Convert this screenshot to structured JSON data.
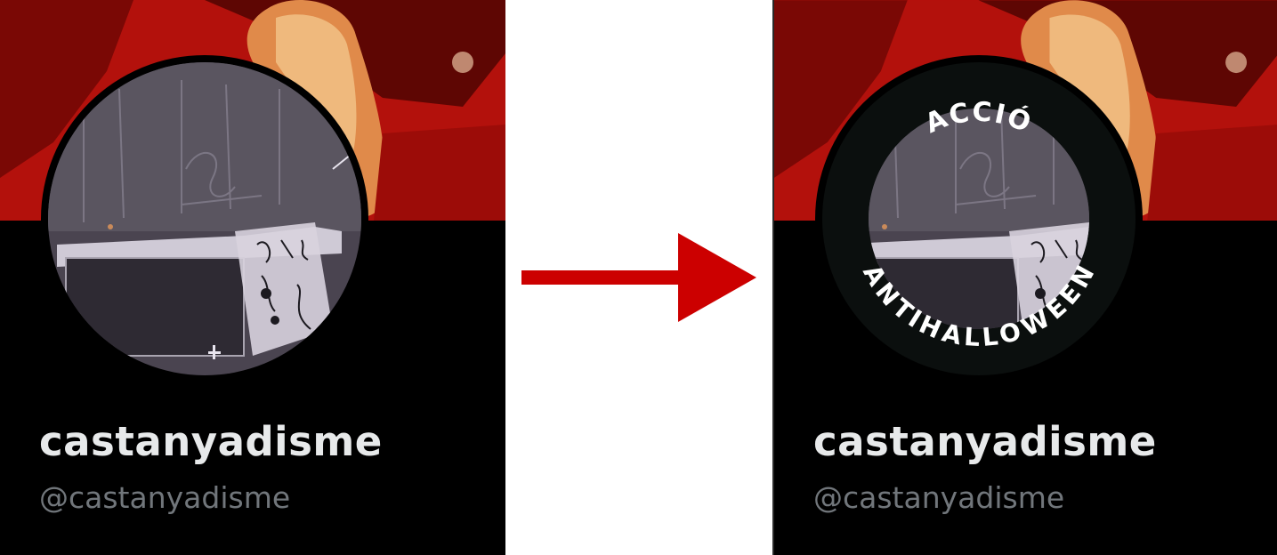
{
  "before": {
    "display_name": "castanyadisme",
    "handle": "@castanyadisme"
  },
  "after": {
    "display_name": "castanyadisme",
    "handle": "@castanyadisme",
    "badge": {
      "top_text": "ACCIÓ",
      "bottom_text": "ANTIHALLOWEEN"
    }
  },
  "colors": {
    "arrow": "#cc0000",
    "panel_bg": "#000000",
    "name": "#e7e9ea",
    "handle": "#71767b",
    "banner": "#b5120d"
  },
  "icons": {
    "transition": "right-arrow-icon"
  }
}
